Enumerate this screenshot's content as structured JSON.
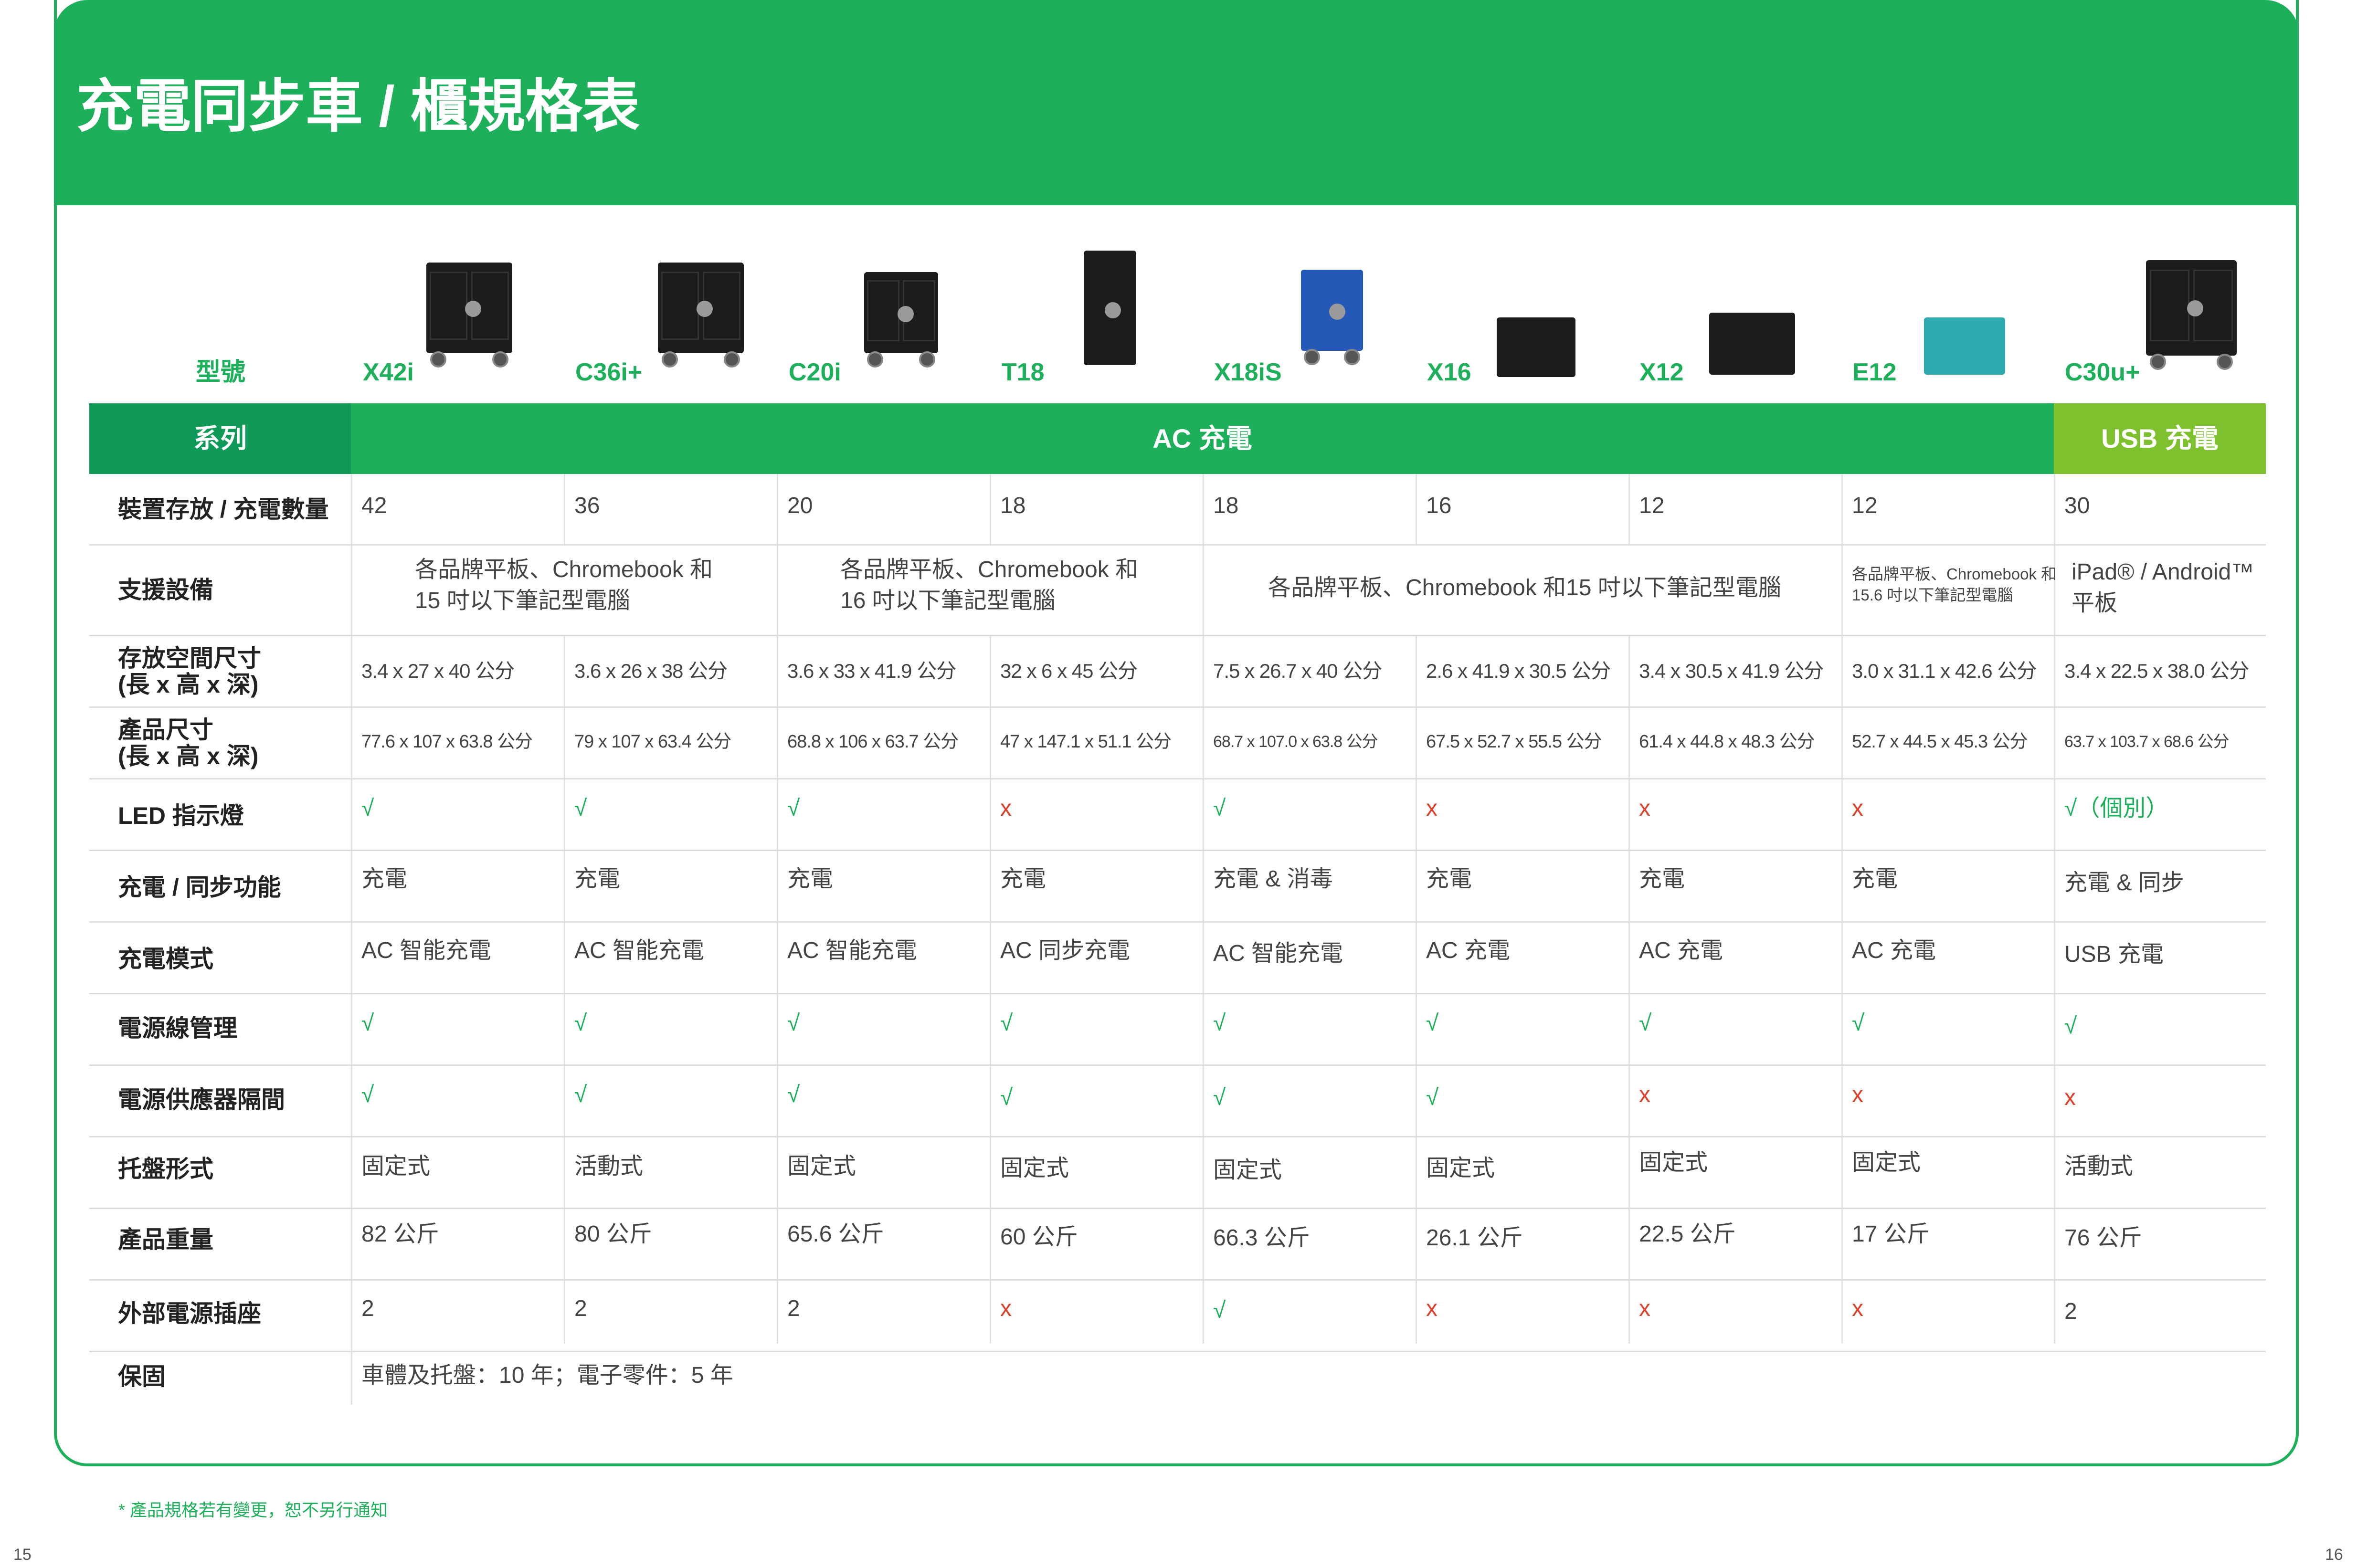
{
  "title": "充電同步車 / 櫃規格表",
  "model_label": "型號",
  "models": [
    "X42i",
    "C36i+",
    "C20i",
    "T18",
    "X18iS",
    "X16",
    "X12",
    "E12",
    "C30u+"
  ],
  "series": {
    "label": "系列",
    "ac": "AC 充電",
    "usb": "USB 充電"
  },
  "rows": {
    "capacity": {
      "label": "裝置存放 / 充電數量",
      "values": [
        "42",
        "36",
        "20",
        "18",
        "18",
        "16",
        "12",
        "12",
        "30"
      ]
    },
    "devices": {
      "label": "支援設備",
      "g1": "各品牌平板、Chromebook 和",
      "g1b": "15 吋以下筆記型電腦",
      "g2": "各品牌平板、Chromebook 和",
      "g2b": "16 吋以下筆記型電腦",
      "g3": "各品牌平板、Chromebook 和15 吋以下筆記型電腦",
      "g4": "各品牌平板、Chromebook 和",
      "g4b": "15.6 吋以下筆記型電腦",
      "g5": "iPad® / Android™",
      "g5b": "平板"
    },
    "storage": {
      "label1": "存放空間尺寸",
      "label2": "(長 x 高 x 深)",
      "values": [
        "3.4 x 27 x 40 公分",
        "3.6 x 26 x 38 公分",
        "3.6 x 33 x 41.9 公分",
        "32 x 6 x 45 公分",
        "7.5 x 26.7 x 40 公分",
        "2.6 x 41.9 x 30.5 公分",
        "3.4 x 30.5 x 41.9 公分",
        "3.0 x 31.1 x 42.6 公分",
        "3.4 x 22.5 x 38.0 公分"
      ]
    },
    "product_size": {
      "label1": "產品尺寸",
      "label2": "(長 x 高 x 深)",
      "values": [
        "77.6 x 107 x 63.8 公分",
        "79 x 107 x 63.4 公分",
        "68.8 x 106 x 63.7 公分",
        "47 x 147.1 x 51.1 公分",
        "68.7 x 107.0 x 63.8 公分",
        "67.5 x 52.7 x 55.5 公分",
        "61.4 x 44.8 x 48.3 公分",
        "52.7 x 44.5 x 45.3 公分",
        "63.7 x 103.7 x 68.6 公分"
      ]
    },
    "led": {
      "label": "LED 指示燈",
      "values": [
        "√",
        "√",
        "√",
        "x",
        "√",
        "x",
        "x",
        "x",
        "√（個別）"
      ]
    },
    "function": {
      "label": "充電 / 同步功能",
      "values": [
        "充電",
        "充電",
        "充電",
        "充電",
        "充電 & 消毒",
        "充電",
        "充電",
        "充電",
        "充電 & 同步"
      ]
    },
    "mode": {
      "label": "充電模式",
      "values": [
        "AC 智能充電",
        "AC 智能充電",
        "AC 智能充電",
        "AC 同步充電",
        "AC 智能充電",
        "AC 充電",
        "AC 充電",
        "AC 充電",
        "USB 充電"
      ]
    },
    "cable": {
      "label": "電源線管理",
      "values": [
        "√",
        "√",
        "√",
        "√",
        "√",
        "√",
        "√",
        "√",
        "√"
      ]
    },
    "psu": {
      "label": "電源供應器隔間",
      "values": [
        "√",
        "√",
        "√",
        "√",
        "√",
        "√",
        "x",
        "x",
        "x"
      ]
    },
    "tray": {
      "label": "托盤形式",
      "values": [
        "固定式",
        "活動式",
        "固定式",
        "固定式",
        "固定式",
        "固定式",
        "固定式",
        "固定式",
        "活動式"
      ]
    },
    "weight": {
      "label": "產品重量",
      "values": [
        "82 公斤",
        "80 公斤",
        "65.6 公斤",
        "60 公斤",
        "66.3 公斤",
        "26.1 公斤",
        "22.5 公斤",
        "17 公斤",
        "76 公斤"
      ]
    },
    "outlet": {
      "label": "外部電源插座",
      "values": [
        "2",
        "2",
        "2",
        "x",
        "√",
        "x",
        "x",
        "x",
        "2"
      ]
    },
    "warranty": {
      "label": "保固",
      "value": "車體及托盤：10 年；電子零件：5 年"
    }
  },
  "footnote": "* 產品規格若有變更，恕不另行通知",
  "page_left": "15",
  "page_right": "16",
  "colors": {
    "green": "#1daf5a",
    "dark_green": "#0f9a57",
    "lime": "#7dc12e",
    "red": "#e0402a"
  }
}
